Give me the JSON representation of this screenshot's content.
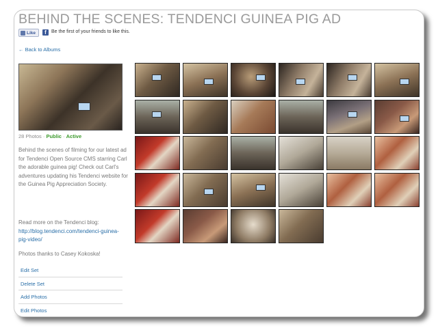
{
  "album": {
    "title": "BEHIND THE SCENES: TENDENCI GUINEA PIG AD",
    "like_label": "Like",
    "fb_text": "Be the first of your friends to like this.",
    "back_label": "← Back to Albums",
    "photo_count": "28 Photos",
    "separator": " · ",
    "public": "Public",
    "active": "Active",
    "description": "Behind the scenes of filming for our latest ad for Tendenci Open Source CMS starring Carl the adorable guinea pig! Check out Carl's adventures updating his Tendenci website for the Guinea Pig Appreciation Society.",
    "more_text": "Read more on the Tendenci blog:",
    "blog_url": "http://blog.tendenci.com/tendenci-guinea-pig-video/",
    "thanks": "Photos thanks to Casey Kokoska!"
  },
  "actions": [
    {
      "label": "Edit Set"
    },
    {
      "label": "Delete Set"
    },
    {
      "label": "Add Photos"
    },
    {
      "label": "Edit Photos"
    }
  ],
  "photos": [
    {
      "tone": "t-a",
      "laptop": true
    },
    {
      "tone": "t-b",
      "laptop": true
    },
    {
      "tone": "t-c",
      "laptop": true
    },
    {
      "tone": "t-d",
      "laptop": true
    },
    {
      "tone": "t-d",
      "laptop": true
    },
    {
      "tone": "t-b",
      "laptop": true
    },
    {
      "tone": "t-e",
      "laptop": true
    },
    {
      "tone": "t-a",
      "laptop": false
    },
    {
      "tone": "t-i",
      "laptop": false
    },
    {
      "tone": "t-e",
      "laptop": false
    },
    {
      "tone": "t-j",
      "laptop": true
    },
    {
      "tone": "t-f",
      "laptop": true
    },
    {
      "tone": "t-g",
      "laptop": false
    },
    {
      "tone": "t-n",
      "laptop": false
    },
    {
      "tone": "t-e",
      "laptop": false
    },
    {
      "tone": "t-h",
      "laptop": false
    },
    {
      "tone": "t-l",
      "laptop": false
    },
    {
      "tone": "t-k",
      "laptop": false
    },
    {
      "tone": "t-g",
      "laptop": false
    },
    {
      "tone": "t-n",
      "laptop": true
    },
    {
      "tone": "t-b",
      "laptop": true
    },
    {
      "tone": "t-h",
      "laptop": false
    },
    {
      "tone": "t-k",
      "laptop": false
    },
    {
      "tone": "t-k",
      "laptop": false
    },
    {
      "tone": "t-g",
      "laptop": false
    },
    {
      "tone": "t-f",
      "laptop": false
    },
    {
      "tone": "t-m",
      "laptop": false
    },
    {
      "tone": "t-n",
      "laptop": false
    }
  ],
  "colors": {
    "title": "#9a9a9a",
    "link": "#2a6fa8",
    "status": "#3c9a2c",
    "facebook": "#3b5998"
  }
}
